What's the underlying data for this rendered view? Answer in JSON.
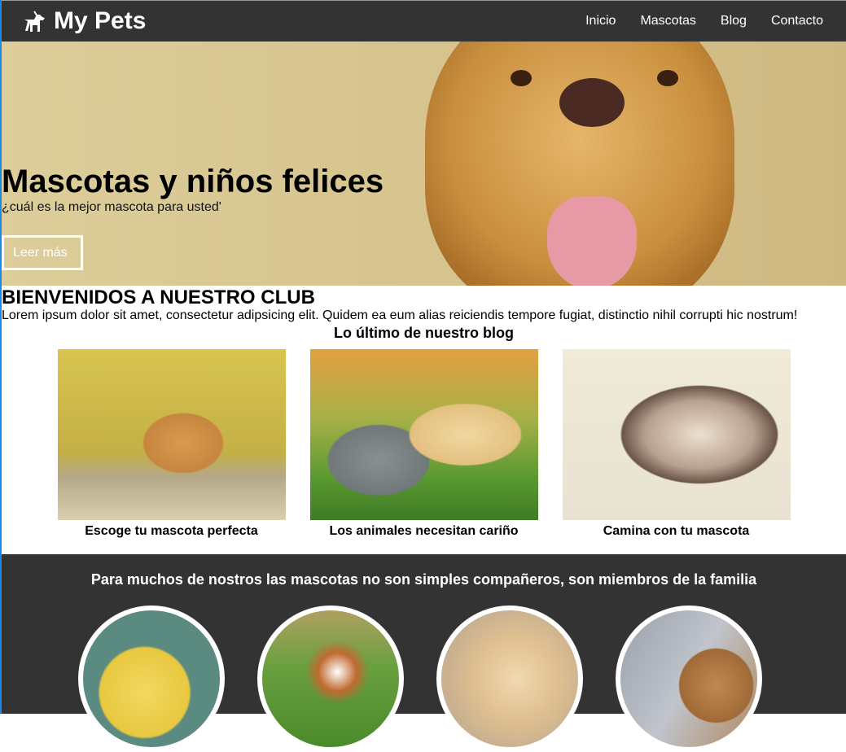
{
  "nav": {
    "brand": "My Pets",
    "logo_icon": "dog-walking-icon",
    "items": [
      "Inicio",
      "Mascotas",
      "Blog",
      "Contacto"
    ]
  },
  "hero": {
    "title": "Mascotas y niños felices",
    "subtitle": "¿cuál es la mejor mascota para usted'",
    "button": "Leer más"
  },
  "welcome": {
    "title": "BIENVENIDOS A NUESTRO CLUB",
    "text": "Lorem ipsum dolor sit amet, consectetur adipsicing elit. Quidem ea eum alias reiciendis tempore fugiat, distinctio nihil corrupti hic nostrum!"
  },
  "blog": {
    "title": "Lo último de nuestro blog",
    "posts": [
      {
        "caption": "Escoge tu mascota perfecta"
      },
      {
        "caption": "Los animales necesitan cariño"
      },
      {
        "caption": "Camina con tu mascota"
      }
    ]
  },
  "family": {
    "title": "Para muchos de nostros las mascotas no son simples compañeros, son miembros de la familia"
  }
}
